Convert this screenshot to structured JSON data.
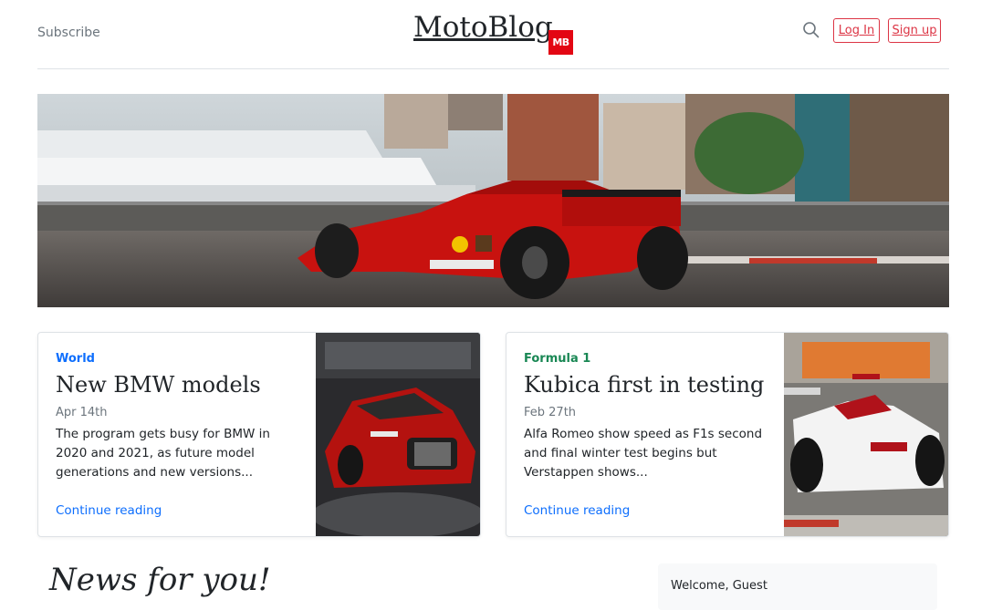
{
  "header": {
    "subscribe_label": "Subscribe",
    "brand_name": "MotoBlog",
    "brand_logo_text": "MB",
    "search_icon": "search-icon",
    "login_label": "Log In",
    "signup_label": "Sign up"
  },
  "colors": {
    "accent_red": "#dc3545",
    "logo_red": "#e30613",
    "link_blue": "#0d6efd",
    "category_green": "#198754"
  },
  "hero": {
    "image": "f1-car-monaco-harbour"
  },
  "posts": [
    {
      "category": "World",
      "title": "New BMW models",
      "date": "Apr 14th",
      "excerpt": "The program gets busy for BMW in 2020 and 2021, as future model generations and new versions...",
      "link_label": "Continue reading",
      "image": "red-bmw-concept-car"
    },
    {
      "category": "Formula 1",
      "title": "Kubica first in testing",
      "date": "Feb 27th",
      "excerpt": "Alfa Romeo show speed as F1s second and final winter test begins but Verstappen shows...",
      "link_label": "Continue reading",
      "image": "alfa-romeo-f1-car"
    }
  ],
  "news_section": {
    "title": "News for you!"
  },
  "sidebar": {
    "welcome_text": "Welcome, Guest"
  }
}
